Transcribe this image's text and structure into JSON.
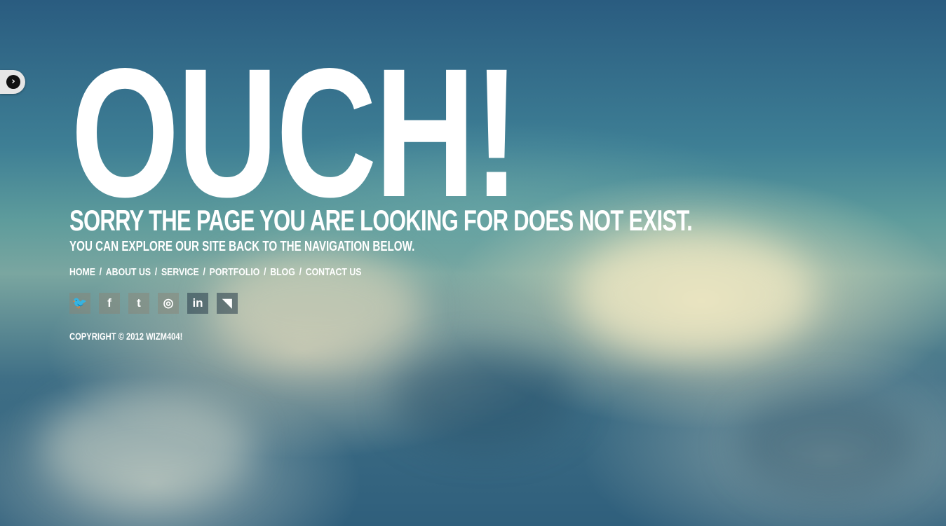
{
  "heading": "OUCH!",
  "message": "SORRY THE PAGE YOU ARE LOOKING FOR DOES NOT EXIST.",
  "submessage": "YOU CAN EXPLORE OUR SITE BACK TO THE NAVIGATION BELOW.",
  "nav": {
    "separator": "/",
    "items": [
      "HOME",
      "ABOUT US",
      "SERVICE",
      "PORTFOLIO",
      "BLOG",
      "CONTACT US"
    ]
  },
  "social": [
    {
      "icon": "twitter-icon",
      "glyph": "🐦"
    },
    {
      "icon": "facebook-icon",
      "glyph": "f"
    },
    {
      "icon": "tumblr-icon",
      "glyph": "t"
    },
    {
      "icon": "dribbble-icon",
      "glyph": "◎"
    },
    {
      "icon": "linkedin-icon",
      "glyph": "in"
    },
    {
      "icon": "rss-icon",
      "glyph": "◥"
    }
  ],
  "copyright": "COPYRIGHT © 2012 WIZM404!",
  "toggle": {
    "icon": "chevron-right-icon",
    "glyph": "›"
  }
}
